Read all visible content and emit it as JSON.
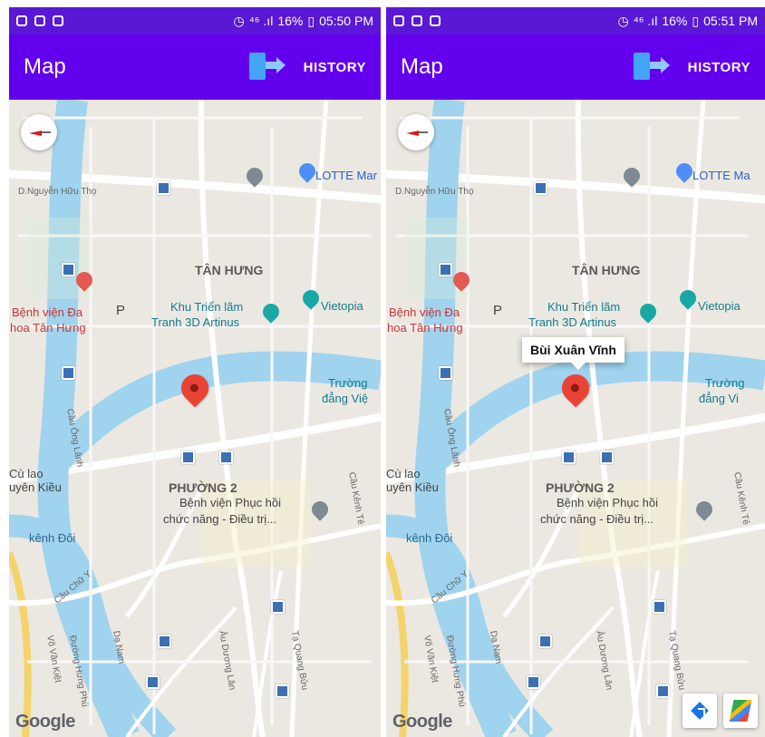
{
  "screens": [
    {
      "status": {
        "signal": "⁴⁶ .ıl",
        "battery": "16%",
        "time": "05:50 PM"
      },
      "appbar": {
        "title": "Map",
        "history": "HISTORY"
      },
      "map": {
        "labels": {
          "street_top": "D.Nguyễn Hữu Thọ",
          "lotte": "LOTTE Mar",
          "district": "TÂN HƯNG",
          "hospital1": "Bệnh viện Đa",
          "hospital2": "hoa Tân Hưng",
          "parking": "P",
          "exhibition1": "Khu Triển lãm",
          "exhibition2": "Tranh 3D Artinus",
          "vietopia": "Vietopia",
          "truong1": "Trường",
          "truong2": "đẳng Việ",
          "culao1": "Cù lao",
          "culao2": "uyên Kiều",
          "phuong": "PHƯỜNG 2",
          "rehab1": "Bệnh viện Phục hồi",
          "rehab2": "chức năng - Điều trị...",
          "kenh": "kênh Đôi",
          "cauchay": "Cầu Chữ Y",
          "vovan": "Võ Văn Kiệt",
          "hung": "Đường Hưng Phú",
          "danam": "Dạ Nam",
          "au": "Âu Dương Lân",
          "taquang": "Tạ Quang Bửu",
          "caukenh": "Cầu Kênh Tẻ",
          "road_vert": "Cầu Ông Lãnh"
        },
        "google": "Google",
        "info": ""
      }
    },
    {
      "status": {
        "signal": "⁴⁶ .ıl",
        "battery": "16%",
        "time": "05:51 PM"
      },
      "appbar": {
        "title": "Map",
        "history": "HISTORY"
      },
      "map": {
        "labels": {
          "street_top": "D.Nguyễn Hữu Thọ",
          "lotte": "LOTTE Ma",
          "district": "TÂN HƯNG",
          "hospital1": "Bệnh viện Đa",
          "hospital2": "hoa Tân Hưng",
          "parking": "P",
          "exhibition1": "Khu Triển lãm",
          "exhibition2": "Tranh 3D Artinus",
          "vietopia": "Vietopia",
          "truong1": "Trường",
          "truong2": "đẳng Vi",
          "culao1": "Cù lao",
          "culao2": "uyên Kiều",
          "phuong": "PHƯỜNG 2",
          "rehab1": "Bệnh viện Phục hồi",
          "rehab2": "chức năng - Điều trị...",
          "kenh": "kênh Đôi",
          "cauchay": "Cầu Chữ Y",
          "vovan": "Võ Văn Kiệt",
          "hung": "Đường Hưng Phú",
          "danam": "Dạ Nam",
          "au": "Âu Dương Lân",
          "taquang": "Tạ Quang Bửu",
          "caukenh": "Cầu Kênh Tẻ",
          "road_vert": "Cầu Ông Lãnh"
        },
        "google": "Google",
        "info": "Bùi Xuân Vĩnh"
      }
    }
  ]
}
